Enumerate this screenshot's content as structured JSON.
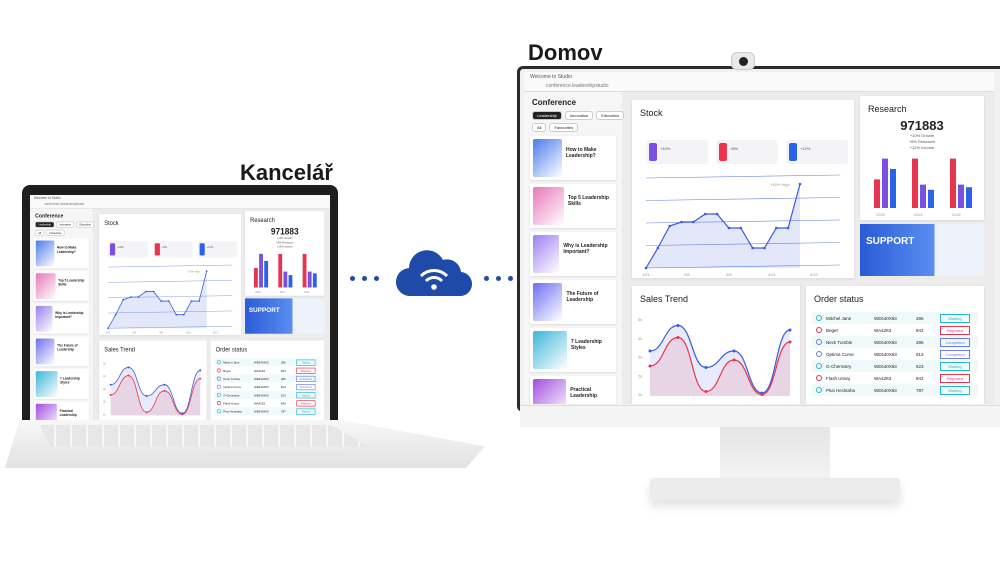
{
  "labels": {
    "office": "Kancelář",
    "home": "Domov"
  },
  "colors": {
    "accent": "#1f4aa8",
    "blue": "#3b5bdb",
    "red": "#e8344e",
    "purple": "#7b4fe0"
  },
  "icons": {
    "cloud": "cloud-wifi-icon"
  },
  "dashboard": {
    "browser_tab": "Welcome to Studio",
    "url": "conference.leadershipstudio",
    "sidebar": {
      "title": "Conference",
      "chips": [
        "Leadership",
        "Innovation",
        "Education"
      ],
      "filters": [
        "All",
        "Favourites"
      ],
      "cards": [
        {
          "title": "How to Make Leadership?",
          "color": "#4a7be8"
        },
        {
          "title": "Top 5 Leadership Skills",
          "color": "#e877b8"
        },
        {
          "title": "Why is Leadership Important?",
          "color": "#9b7ef0"
        },
        {
          "title": "The Future of Leadership",
          "color": "#6d6ff0"
        },
        {
          "title": "7 Leadership Styles",
          "color": "#3bb6d8"
        },
        {
          "title": "Practical Leadership",
          "color": "#a24de0"
        }
      ]
    },
    "stock": {
      "title": "Stock",
      "stats": [
        {
          "color": "#7b4fe0",
          "text": "+10%"
        },
        {
          "color": "#e8344e",
          "text": "+8%"
        },
        {
          "color": "#2b63e8",
          "text": "+12%"
        }
      ],
      "peak_label": "+16% High",
      "x_labels": [
        "1/21",
        "2/8",
        "3/8",
        "4/21",
        "5/22"
      ],
      "values": [
        0,
        1,
        2.1,
        2.3,
        2.3,
        2.7,
        2.7,
        2,
        2,
        1,
        1,
        2,
        2,
        4.2
      ]
    },
    "research": {
      "title": "Research",
      "value": "971883",
      "legend": [
        "+10% Growth",
        "+8% Research",
        "+12% Income"
      ],
      "groups": [
        {
          "label": "2020",
          "values": [
            0.55,
            0.95,
            0.75
          ]
        },
        {
          "label": "2021",
          "values": [
            0.95,
            0.45,
            0.35
          ]
        },
        {
          "label": "2022",
          "values": [
            0.95,
            0.45,
            0.4
          ]
        }
      ]
    },
    "support": {
      "title": "SUPPORT"
    },
    "sales": {
      "title": "Sales Trend",
      "y_labels": [
        "5k",
        "4k",
        "3k",
        "2k",
        "1k"
      ],
      "series": [
        {
          "color": "#3b5bdb",
          "values": [
            3,
            4.7,
            1.9,
            3,
            0.2,
            4.4
          ]
        },
        {
          "color": "#e8344e",
          "values": [
            2,
            3.9,
            0.3,
            2.4,
            0.1,
            3.6
          ]
        }
      ]
    },
    "orders": {
      "title": "Order status",
      "rows": [
        {
          "name": "Mitchel Jane",
          "id": "WE640X63",
          "amt": "286",
          "status": "Waiting",
          "color": "#27b7c9"
        },
        {
          "name": "Beget",
          "id": "WA4263",
          "amt": "843",
          "status": "Rejected",
          "color": "#e8344e"
        },
        {
          "name": "Neck Tumble",
          "id": "WE640X63",
          "amt": "286",
          "status": "Completed",
          "color": "#6b7de8"
        },
        {
          "name": "Optima Curve",
          "id": "WE640X63",
          "amt": "813",
          "status": "Completed",
          "color": "#6b7de8"
        },
        {
          "name": "G-Chemistry",
          "id": "WE640X63",
          "amt": "623",
          "status": "Waiting",
          "color": "#27b7c9"
        },
        {
          "name": "Flash Unsaj",
          "id": "WA4263",
          "amt": "843",
          "status": "Rejected",
          "color": "#e8344e"
        },
        {
          "name": "Plus Hecktaha",
          "id": "WE640X63",
          "amt": "787",
          "status": "Waiting",
          "color": "#27b7c9"
        }
      ]
    }
  }
}
